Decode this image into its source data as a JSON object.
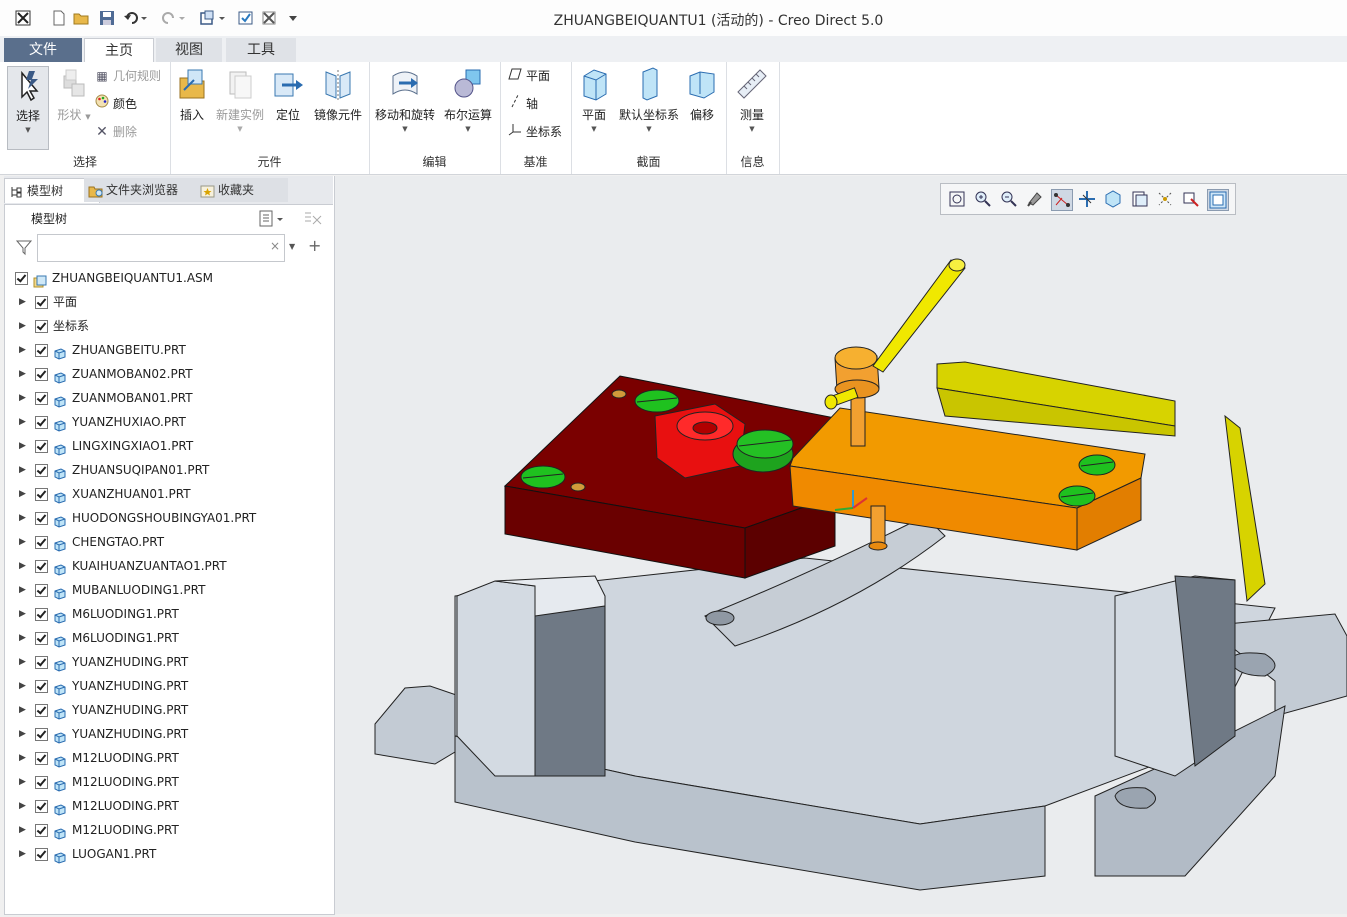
{
  "window": {
    "title": "ZHUANGBEIQUANTU1 (活动的) - Creo Direct 5.0"
  },
  "quick_access": [
    "app-logo-icon",
    "new-icon",
    "open-icon",
    "save-icon",
    "undo-icon",
    "redo-icon",
    "regenerate-icon",
    "window-icon",
    "close-window-icon",
    "more-icon"
  ],
  "tabs": [
    {
      "label": "文件"
    },
    {
      "label": "主页"
    },
    {
      "label": "视图"
    },
    {
      "label": "工具"
    }
  ],
  "ribbon": {
    "select_group": {
      "label": "选择",
      "select": "选择",
      "shape": "形状",
      "geometry_rules": "几何规则",
      "color": "颜色",
      "delete": "删除"
    },
    "component_group": {
      "label": "元件",
      "insert": "插入",
      "new_instance": "新建实例",
      "locate": "定位",
      "mirror": "镜像元件"
    },
    "edit_group": {
      "label": "编辑",
      "move_rotate": "移动和旋转",
      "boolean": "布尔运算"
    },
    "datum_group": {
      "label": "基准",
      "plane": "平面",
      "axis": "轴",
      "csys": "坐标系"
    },
    "section_group": {
      "label": "截面",
      "plane": "平面",
      "default_csys": "默认坐标系",
      "offset": "偏移"
    },
    "info_group": {
      "label": "信息",
      "measure": "测量"
    }
  },
  "nav_tabs": [
    {
      "label": "模型树"
    },
    {
      "label": "文件夹浏览器"
    },
    {
      "label": "收藏夹"
    }
  ],
  "model_tree": {
    "header": "模型树",
    "filter_value": "",
    "root": "ZHUANGBEIQUANTU1.ASM",
    "items": [
      {
        "label": "平面",
        "type": "plane"
      },
      {
        "label": "坐标系",
        "type": "csys"
      },
      {
        "label": "ZHUANGBEITU.PRT",
        "type": "part"
      },
      {
        "label": "ZUANMOBAN02.PRT",
        "type": "part"
      },
      {
        "label": "ZUANMOBAN01.PRT",
        "type": "part"
      },
      {
        "label": "YUANZHUXIAO.PRT",
        "type": "part"
      },
      {
        "label": "LINGXINGXIAO1.PRT",
        "type": "part"
      },
      {
        "label": "ZHUANSUQIPAN01.PRT",
        "type": "part"
      },
      {
        "label": "XUANZHUAN01.PRT",
        "type": "part"
      },
      {
        "label": "HUODONGSHOUBINGYA01.PRT",
        "type": "part"
      },
      {
        "label": "CHENGTAO.PRT",
        "type": "part"
      },
      {
        "label": "KUAIHUANZUANTAO1.PRT",
        "type": "part"
      },
      {
        "label": "MUBANLUODING1.PRT",
        "type": "part"
      },
      {
        "label": "M6LUODING1.PRT",
        "type": "part"
      },
      {
        "label": "M6LUODING1.PRT",
        "type": "part"
      },
      {
        "label": "YUANZHUDING.PRT",
        "type": "part"
      },
      {
        "label": "YUANZHUDING.PRT",
        "type": "part"
      },
      {
        "label": "YUANZHUDING.PRT",
        "type": "part"
      },
      {
        "label": "YUANZHUDING.PRT",
        "type": "part"
      },
      {
        "label": "M12LUODING.PRT",
        "type": "part"
      },
      {
        "label": "M12LUODING.PRT",
        "type": "part"
      },
      {
        "label": "M12LUODING.PRT",
        "type": "part"
      },
      {
        "label": "M12LUODING.PRT",
        "type": "part"
      },
      {
        "label": "LUOGAN1.PRT",
        "type": "part"
      }
    ]
  },
  "view_toolbar": [
    "refit-icon",
    "zoom-in-icon",
    "zoom-out-icon",
    "repaint-icon",
    "datum-display-icon",
    "spin-center-icon",
    "saved-orientations-icon",
    "display-style-icon",
    "annotation-display-icon",
    "plane-display-icon",
    "view-manager-icon"
  ],
  "colors": {
    "file_tab": "#5a6f8c",
    "viewport_bg": "#eaecee",
    "base_gray": "#c7cfd8",
    "plate_red": "#7a0000",
    "arm_orange": "#f29a00",
    "screw_green": "#1fc11f",
    "handle_yellow": "#f0e800",
    "block_yellow": "#d7d300"
  }
}
